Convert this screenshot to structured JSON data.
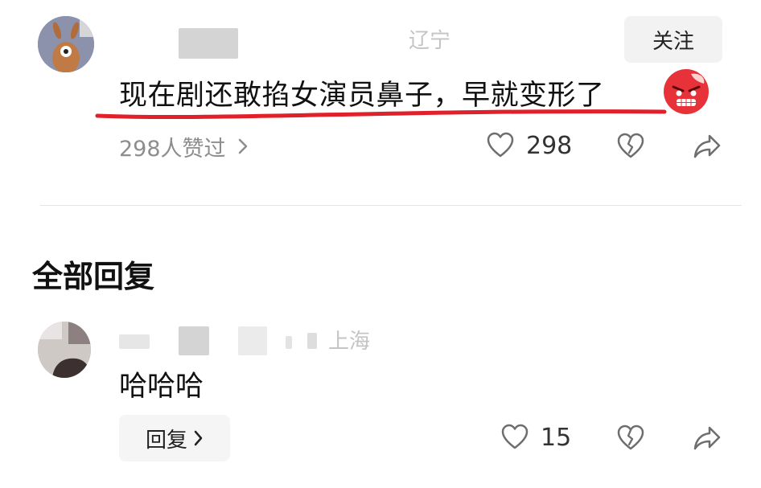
{
  "comment": {
    "location": "辽宁",
    "follow_label": "关注",
    "text": "现在剧还敢掐女演员鼻子，早就变形了",
    "emoji": "angry-face-emoji",
    "liked_by": "298人赞过",
    "likes": "298"
  },
  "replies": {
    "section_title": "全部回复",
    "items": [
      {
        "location": "上海",
        "text": "哈哈哈",
        "reply_label": "回复",
        "likes": "15"
      }
    ]
  },
  "colors": {
    "underline": "#e0202a",
    "follow_bg": "#f2f2f2",
    "muted_text": "#8d8d8d",
    "icon_gray": "#6e6e6e"
  },
  "icons": [
    "heart-outline-icon",
    "broken-heart-icon",
    "share-icon",
    "chevron-right-icon"
  ]
}
